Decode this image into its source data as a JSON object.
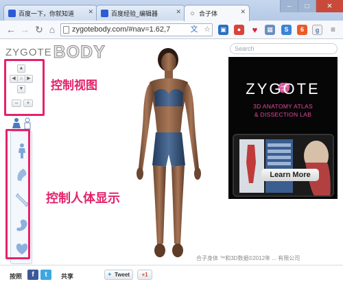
{
  "browser": {
    "tabs": [
      {
        "label": "百度一下，你就知道"
      },
      {
        "label": "百度经验_编辑器"
      },
      {
        "label": "合子体"
      }
    ],
    "url": "zygotebody.com/#nav=1.62,7"
  },
  "page": {
    "logo_zygote": "ZYGOTE",
    "logo_body": "BODY",
    "search_placeholder": "Search",
    "annotation_view": "控制视图",
    "annotation_layers": "控制人体显示",
    "copyright": "合子身体 ™和3D数据©2012年 ... 有限公司",
    "ad": {
      "title": "ZYGOTE",
      "line1": "3D ANATOMY ATLAS",
      "line2": "& DISSECTION LAB",
      "cta": "Learn More"
    },
    "footer": {
      "follow_label": "按照",
      "share_label": "共享",
      "tweet_label": "Tweet",
      "gplus_label": "+1"
    }
  },
  "colors": {
    "accent_pink": "#e3226a",
    "ad_bg": "#060606",
    "ad_pink": "#e34a9c"
  }
}
